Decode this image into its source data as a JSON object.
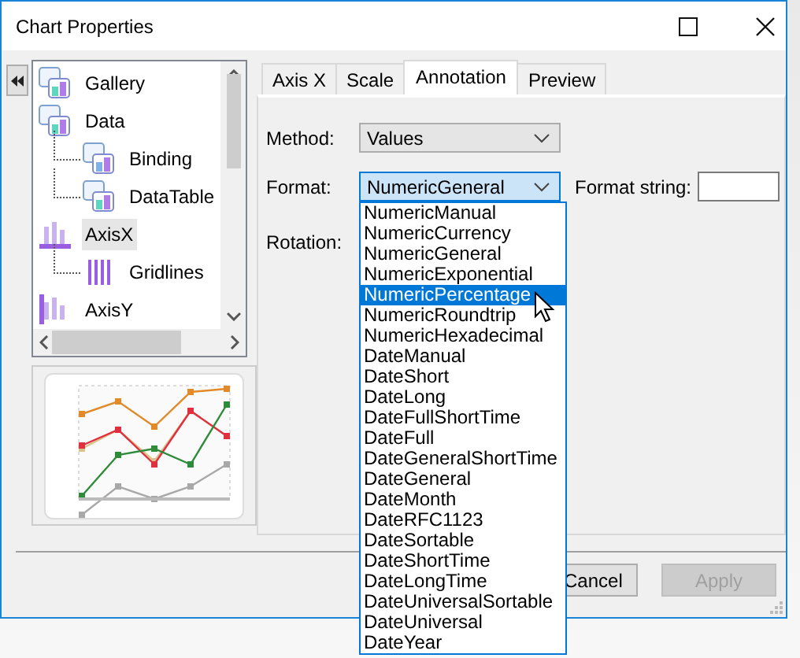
{
  "window": {
    "title": "Chart Properties"
  },
  "tree": {
    "items": [
      {
        "label": "Gallery",
        "kind": "gallery",
        "selected": false
      },
      {
        "label": "Data",
        "kind": "data",
        "selected": false,
        "children": [
          {
            "label": "Binding",
            "kind": "binding",
            "selected": false
          },
          {
            "label": "DataTable",
            "kind": "datatable",
            "selected": false
          }
        ]
      },
      {
        "label": "AxisX",
        "kind": "axisx",
        "selected": true,
        "children": [
          {
            "label": "Gridlines",
            "kind": "gridlines",
            "selected": false
          }
        ]
      },
      {
        "label": "AxisY",
        "kind": "axisy",
        "selected": false
      }
    ]
  },
  "tabs": [
    {
      "label": "Axis X",
      "selected": false
    },
    {
      "label": "Scale",
      "selected": false
    },
    {
      "label": "Annotation",
      "selected": true
    },
    {
      "label": "Preview",
      "selected": false
    }
  ],
  "form": {
    "method": {
      "label": "Method:",
      "value": "Values"
    },
    "format": {
      "label": "Format:",
      "value": "NumericGeneral",
      "expanded": true
    },
    "format_string": {
      "label": "Format string:"
    },
    "rotation": {
      "label": "Rotation:"
    }
  },
  "format_options": [
    {
      "label": "NumericManual",
      "selected": false
    },
    {
      "label": "NumericCurrency",
      "selected": false
    },
    {
      "label": "NumericGeneral",
      "selected": false
    },
    {
      "label": "NumericExponential",
      "selected": false
    },
    {
      "label": "NumericPercentage",
      "selected": true
    },
    {
      "label": "NumericRoundtrip",
      "selected": false
    },
    {
      "label": "NumericHexadecimal",
      "selected": false
    },
    {
      "label": "DateManual",
      "selected": false
    },
    {
      "label": "DateShort",
      "selected": false
    },
    {
      "label": "DateLong",
      "selected": false
    },
    {
      "label": "DateFullShortTime",
      "selected": false
    },
    {
      "label": "DateFull",
      "selected": false
    },
    {
      "label": "DateGeneralShortTime",
      "selected": false
    },
    {
      "label": "DateGeneral",
      "selected": false
    },
    {
      "label": "DateMonth",
      "selected": false
    },
    {
      "label": "DateRFC1123",
      "selected": false
    },
    {
      "label": "DateSortable",
      "selected": false
    },
    {
      "label": "DateShortTime",
      "selected": false
    },
    {
      "label": "DateLongTime",
      "selected": false
    },
    {
      "label": "DateUniversalSortable",
      "selected": false
    },
    {
      "label": "DateUniversal",
      "selected": false
    },
    {
      "label": "DateYear",
      "selected": false
    }
  ],
  "buttons": [
    {
      "label": "Cancel",
      "disabled": false
    },
    {
      "label": "Apply",
      "disabled": true
    }
  ]
}
